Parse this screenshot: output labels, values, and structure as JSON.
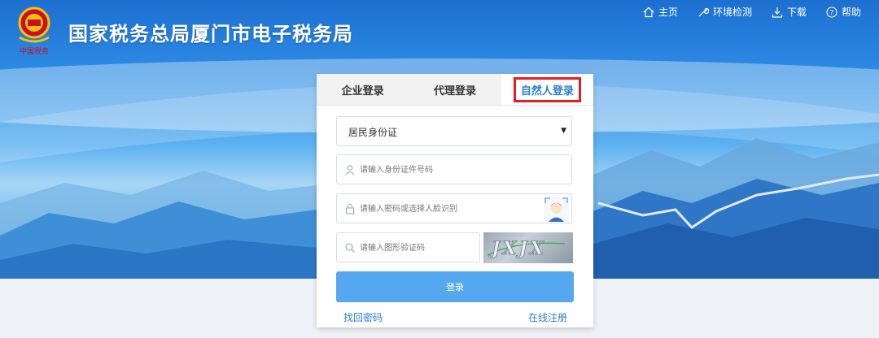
{
  "header": {
    "site_title": "国家税务总局厦门市电子税务局",
    "emblem_caption": "中国税务",
    "nav": [
      {
        "label": "主页",
        "icon": "home-icon"
      },
      {
        "label": "环境检测",
        "icon": "wrench-icon"
      },
      {
        "label": "下载",
        "icon": "download-icon"
      },
      {
        "label": "帮助",
        "icon": "help-icon"
      }
    ]
  },
  "login": {
    "tabs": [
      {
        "label": "企业登录",
        "active": false
      },
      {
        "label": "代理登录",
        "active": false
      },
      {
        "label": "自然人登录",
        "active": true
      }
    ],
    "id_type": {
      "selected": "居民身份证"
    },
    "id_number": {
      "placeholder": "请输入身份证件号码",
      "icon": "user-icon"
    },
    "password": {
      "placeholder": "请输入密码或选择人脸识别",
      "icon": "lock-icon"
    },
    "captcha": {
      "placeholder": "请输入图形验证码",
      "icon": "search-icon",
      "image_text": "JXJX"
    },
    "submit_label": "登录",
    "forgot_password": "找回密码",
    "register": "在线注册"
  },
  "colors": {
    "accent": "#2a7fd0",
    "login_button": "#55a8ef",
    "active_tab_border": "#e02020"
  }
}
